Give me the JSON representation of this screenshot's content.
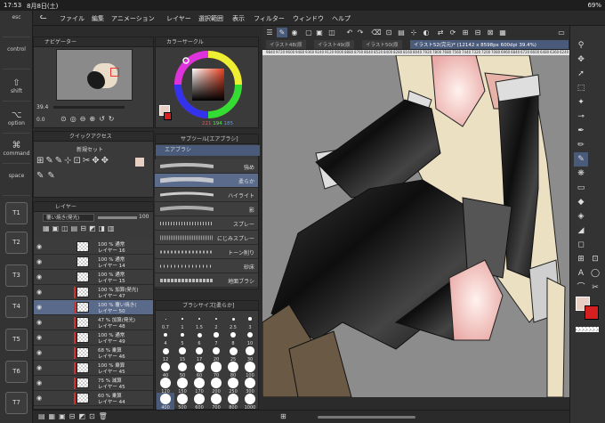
{
  "status": {
    "time": "17:53",
    "date": "8月8日(土)",
    "battery": "69%"
  },
  "menu": [
    "ファイル",
    "編集",
    "アニメーション",
    "レイヤー",
    "選択範囲",
    "表示",
    "フィルター",
    "ウィンドウ",
    "ヘルプ"
  ],
  "keys": [
    {
      "label": "esc",
      "glyph": ""
    },
    {
      "label": "control",
      "glyph": ""
    },
    {
      "label": "shift",
      "glyph": "⇧"
    },
    {
      "label": "option",
      "glyph": "⌥"
    },
    {
      "label": "command",
      "glyph": "⌘"
    },
    {
      "label": "space",
      "glyph": ""
    }
  ],
  "tkeys": [
    "T1",
    "T2",
    "T3",
    "T4",
    "T5",
    "T6",
    "T7"
  ],
  "navigator": {
    "title": "ナビゲーター",
    "zoom": "39.4",
    "angle": "0.0"
  },
  "color": {
    "title": "カラーサークル",
    "values": [
      "221",
      "194",
      "185"
    ],
    "main": "#e8cfc4",
    "sub": "#d42020"
  },
  "quick": {
    "tab": "クイックアクセス",
    "set": "新規セット"
  },
  "subtool": {
    "title": "サブツール[エアブラシ]",
    "group": "エアブラシ",
    "brushes": [
      "強め",
      "柔らか",
      "ハイライト",
      "影",
      "スプレー",
      "にじみスプレー",
      "トーン削り",
      "砂床",
      "地面ブラシ"
    ]
  },
  "brushsize": {
    "title": "ブラシサイズ[柔らか]",
    "sizes": [
      "0.7",
      "1",
      "1.5",
      "2",
      "2.5",
      "3",
      "4",
      "5",
      "6",
      "7",
      "8",
      "10",
      "12",
      "15",
      "17",
      "20",
      "25",
      "30",
      "40",
      "50",
      "60",
      "70",
      "80",
      "100",
      "120",
      "150",
      "170",
      "200",
      "250",
      "300",
      "400",
      "500",
      "600",
      "700",
      "800",
      "1000"
    ]
  },
  "layers": {
    "title": "レイヤー",
    "blend": "覆い焼き(発光)",
    "opacity": "100",
    "rows": [
      {
        "a": "100 % 通常",
        "b": "レイヤー 16",
        "red": false,
        "sel": false
      },
      {
        "a": "100 % 通常",
        "b": "レイヤー 14",
        "red": false,
        "sel": false
      },
      {
        "a": "100 % 通常",
        "b": "レイヤー 15",
        "red": false,
        "sel": false
      },
      {
        "a": "100 % 加算(発光)",
        "b": "レイヤー 47",
        "red": true,
        "sel": false
      },
      {
        "a": "100 % 覆い焼き(",
        "b": "レイヤー 50",
        "red": true,
        "sel": true
      },
      {
        "a": "47 % 加算(発光)",
        "b": "レイヤー 48",
        "red": true,
        "sel": false
      },
      {
        "a": "100 % 通常",
        "b": "レイヤー 49",
        "red": true,
        "sel": false
      },
      {
        "a": "68 % 乗算",
        "b": "レイヤー 46",
        "red": true,
        "sel": false
      },
      {
        "a": "100 % 乗算",
        "b": "レイヤー 45",
        "red": true,
        "sel": false
      },
      {
        "a": "75 % 減算",
        "b": "レイヤー 45",
        "red": true,
        "sel": false
      },
      {
        "a": "60 % 乗算",
        "b": "レイヤー 44",
        "red": true,
        "sel": false
      }
    ]
  },
  "tabs": [
    "イラスト48(原",
    "イラスト49(原",
    "イラスト50(原",
    "イラスト52(完元)* (12142 x 8598px 600dpi 39.4%)"
  ],
  "ruler": [
    "9840",
    "9720",
    "9600",
    "9480",
    "9360",
    "9240",
    "9120",
    "9000",
    "8880",
    "8760",
    "8640",
    "8520",
    "8400",
    "8280",
    "8160",
    "8040",
    "7920",
    "7800",
    "7680",
    "7560",
    "7440",
    "7320",
    "7200",
    "7080",
    "6960",
    "6840",
    "6720",
    "6600",
    "6480",
    "6360",
    "6240",
    "6120",
    "6000"
  ]
}
